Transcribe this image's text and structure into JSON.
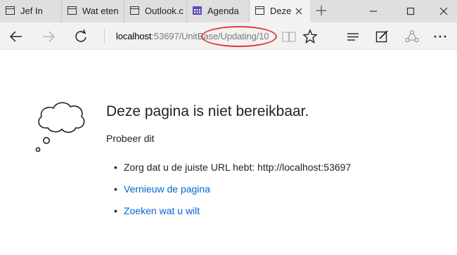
{
  "tabs": [
    {
      "title": "Jef In",
      "icon": "page-icon"
    },
    {
      "title": "Wat eten",
      "icon": "page-icon"
    },
    {
      "title": "Outlook.c",
      "icon": "page-icon"
    },
    {
      "title": "Agenda",
      "icon": "calendar-icon"
    },
    {
      "title": "Deze",
      "icon": "page-icon",
      "active": true
    }
  ],
  "address_bar": {
    "host": "localhost",
    "path": ":53697/UnitBase/Updating/10"
  },
  "error": {
    "title": "Deze pagina is niet bereikbaar.",
    "try_label": "Probeer dit",
    "suggestions": [
      "Zorg dat u de juiste URL hebt: http://localhost:53697",
      "Vernieuw de pagina",
      "Zoeken wat u wilt"
    ]
  },
  "colors": {
    "link": "#0066cc",
    "annotation": "#e03a3a",
    "tabbar": "#dfdfdf",
    "toolbar": "#f2f2f2"
  }
}
